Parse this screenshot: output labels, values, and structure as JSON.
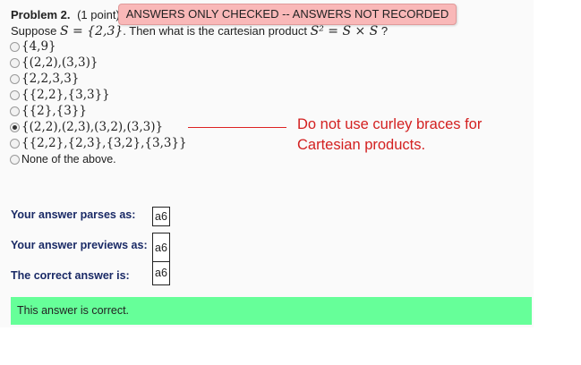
{
  "problem": {
    "title": "Problem 2.",
    "points": "(1 point)",
    "notice": "ANSWERS ONLY CHECKED -- ANSWERS NOT RECORDED"
  },
  "question": {
    "prefix": "Suppose",
    "set_def": "S = {2,3}",
    "middle": ". Then what is the cartesian product",
    "product": "S² = S × S",
    "suffix": "?"
  },
  "options": [
    {
      "label": "{4,9}",
      "checked": false
    },
    {
      "label": "{(2,2),(3,3)}",
      "checked": false
    },
    {
      "label": "{2,2,3,3}",
      "checked": false
    },
    {
      "label": "{{2,2},{3,3}}",
      "checked": false
    },
    {
      "label": "{{2},{3}}",
      "checked": false
    },
    {
      "label": "{(2,2),(2,3),(3,2),(3,3)}",
      "checked": true
    },
    {
      "label": "{{2,2},{2,3},{3,2},{3,3}}",
      "checked": false
    },
    {
      "label": "None of the above.",
      "checked": false
    }
  ],
  "annotation": {
    "line1": "Do not use curley braces for",
    "line2": "Cartesian products.",
    "color": "#d32020"
  },
  "results": {
    "parses_label": "Your answer parses as:",
    "parses_value": "a6",
    "previews_label": "Your answer previews as:",
    "previews_value": "a6",
    "correct_label": "The correct answer is:",
    "correct_value": "a6"
  },
  "feedback": {
    "message": "This answer is correct.",
    "color": "#66ff99"
  }
}
